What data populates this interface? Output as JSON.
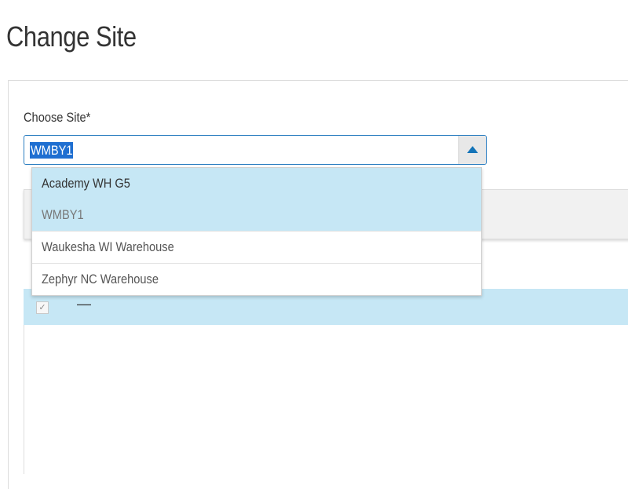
{
  "page": {
    "title": "Change Site"
  },
  "form": {
    "site_label": "Choose Site*",
    "site_value": "WMBY1"
  },
  "dropdown": {
    "options": [
      {
        "label": "Academy WH G5",
        "state": "hover"
      },
      {
        "label": "WMBY1",
        "state": "selected"
      },
      {
        "label": "Waukesha WI Warehouse",
        "state": "normal"
      },
      {
        "label": "Zephyr NC Warehouse",
        "state": "normal"
      }
    ]
  },
  "grid": {
    "row_check": "✓",
    "row_value": "—"
  },
  "colors": {
    "selection_blue": "#1f6fd1",
    "row_highlight": "#c6e7f5",
    "accent": "#1474b8"
  },
  "icons": {
    "toggle": "caret-up-icon",
    "checkbox": "checkmark-icon"
  }
}
